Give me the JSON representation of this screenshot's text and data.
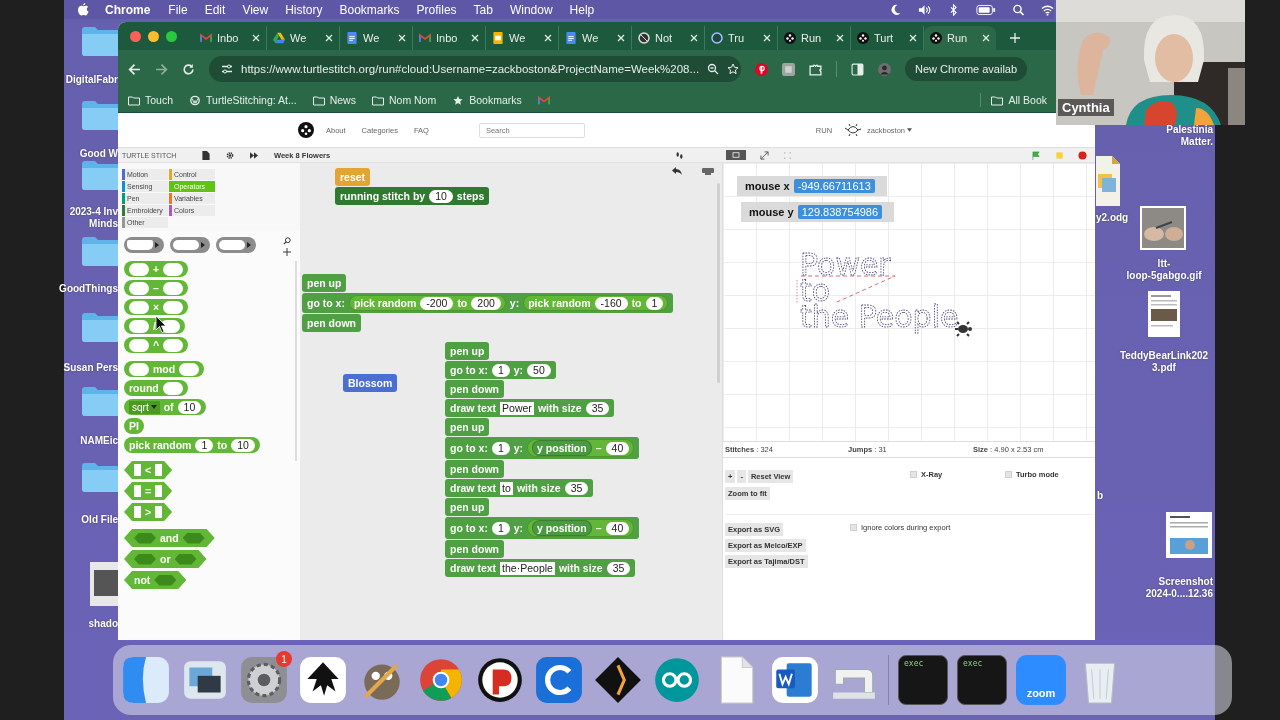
{
  "menu_bar": {
    "app": "Chrome",
    "items": [
      "File",
      "Edit",
      "View",
      "History",
      "Bookmarks",
      "Profiles",
      "Tab",
      "Window",
      "Help"
    ]
  },
  "desktop_left": [
    {
      "kind": "folder",
      "lines": [
        "DigitalFabr"
      ]
    },
    {
      "kind": "folder",
      "lines": [
        "Good W"
      ]
    },
    {
      "kind": "folder",
      "lines": [
        "2023-4 Inv",
        "Minds"
      ]
    },
    {
      "kind": "folder",
      "lines": [
        "GoodThings"
      ]
    },
    {
      "kind": "folder",
      "lines": [
        "Susan Pers"
      ]
    },
    {
      "kind": "folder",
      "lines": [
        "NAMEic"
      ]
    },
    {
      "kind": "folder",
      "lines": [
        "Old File"
      ]
    },
    {
      "kind": "file",
      "lines": [
        "shado"
      ]
    }
  ],
  "desktop_right": [
    {
      "kind": "label",
      "lines": [
        "Palestinia",
        "Matter."
      ]
    },
    {
      "kind": "odg",
      "lines": [
        "y2.odg"
      ]
    },
    {
      "kind": "gif",
      "lines": [
        "ltt-",
        "loop-5gabgo.gif"
      ]
    },
    {
      "kind": "pdf",
      "lines": [
        "TeddyBearLink202",
        "3.pdf"
      ]
    },
    {
      "kind": "label",
      "lines": [
        "b"
      ]
    },
    {
      "kind": "screenshot",
      "lines": [
        "Screenshot",
        "2024-0....12.36"
      ]
    }
  ],
  "browser": {
    "tabs": [
      {
        "kind": "gmail",
        "label": "Inbo",
        "selected": false
      },
      {
        "kind": "drive",
        "label": "We",
        "selected": false
      },
      {
        "kind": "docs",
        "label": "We",
        "selected": false
      },
      {
        "kind": "gmail",
        "label": "Inbo",
        "selected": false
      },
      {
        "kind": "slides",
        "label": "We",
        "selected": false
      },
      {
        "kind": "docs",
        "label": "We",
        "selected": false
      },
      {
        "kind": "notion",
        "label": "Not",
        "selected": false
      },
      {
        "kind": "letter",
        "label": "Tru",
        "selected": false
      },
      {
        "kind": "turtle",
        "label": "Run",
        "selected": false
      },
      {
        "kind": "turtle",
        "label": "Turt",
        "selected": false
      },
      {
        "kind": "turtle",
        "label": "Run",
        "selected": true
      }
    ],
    "url": "https://www.turtlestitch.org/run#cloud:Username=zackboston&ProjectName=Week%208...",
    "update_button": "New Chrome availab",
    "bookmarks": [
      {
        "kind": "folder",
        "label": "Touch"
      },
      {
        "kind": "wordpress",
        "label": "TurtleStitching: At..."
      },
      {
        "kind": "folder",
        "label": "News"
      },
      {
        "kind": "folder",
        "label": "Nom Nom"
      },
      {
        "kind": "star",
        "label": "Bookmarks"
      },
      {
        "kind": "gmail"
      }
    ],
    "all_bookmarks": "All Book"
  },
  "site_header": {
    "nav": [
      "About",
      "Categories",
      "FAQ"
    ],
    "search_placeholder": "Search",
    "run": "RUN",
    "user": "zackboston"
  },
  "ide": {
    "logo": "TURTLE STITCH",
    "project_name": "Week 8 Flowers",
    "categories": [
      {
        "label": "Motion",
        "color": "#4a6cd4",
        "selected": false
      },
      {
        "label": "Control",
        "color": "#e6a822",
        "selected": false
      },
      {
        "label": "Sensing",
        "color": "#0494dc",
        "selected": false
      },
      {
        "label": "Operators",
        "color": "#62c213",
        "selected": true
      },
      {
        "label": "Pen",
        "color": "#00a178",
        "selected": false
      },
      {
        "label": "Variables",
        "color": "#f3761d",
        "selected": false
      },
      {
        "label": "Embroidery",
        "color": "#2e7d32",
        "selected": false
      },
      {
        "label": "Colors",
        "color": "#b053c9",
        "selected": false
      },
      {
        "label": "Other",
        "color": "#969696",
        "selected": false
      }
    ],
    "palette": [
      [
        {
          "kind": "command_ring"
        },
        {
          "kind": "reporter_ring"
        },
        {
          "kind": "predicate_ring"
        }
      ],
      [
        {
          "kind": "reporter",
          "color": "#62b836",
          "parts": [
            {
              "kind": "empty"
            },
            {
              "kind": "label",
              "text": "+"
            },
            {
              "kind": "empty"
            }
          ]
        },
        {
          "kind": "reporter",
          "color": "#62b836",
          "parts": [
            {
              "kind": "empty"
            },
            {
              "kind": "label",
              "text": "–"
            },
            {
              "kind": "empty"
            }
          ]
        },
        {
          "kind": "reporter",
          "color": "#62b836",
          "parts": [
            {
              "kind": "empty"
            },
            {
              "kind": "label",
              "text": "×"
            },
            {
              "kind": "empty"
            }
          ]
        },
        {
          "kind": "reporter",
          "color": "#62b836",
          "parts": [
            {
              "kind": "empty"
            },
            {
              "kind": "label",
              "text": "/"
            },
            {
              "kind": "empty"
            }
          ]
        },
        {
          "kind": "reporter",
          "color": "#62b836",
          "parts": [
            {
              "kind": "empty"
            },
            {
              "kind": "label",
              "text": "^"
            },
            {
              "kind": "empty"
            }
          ]
        }
      ],
      [
        {
          "kind": "reporter",
          "color": "#62b836",
          "parts": [
            {
              "kind": "empty"
            },
            {
              "kind": "label",
              "text": "mod"
            },
            {
              "kind": "empty"
            }
          ]
        },
        {
          "kind": "reporter",
          "color": "#62b836",
          "parts": [
            {
              "kind": "label",
              "text": "round"
            },
            {
              "kind": "empty"
            }
          ]
        },
        {
          "kind": "reporter",
          "color": "#62b836",
          "parts": [
            {
              "kind": "dropdown",
              "text": "sqrt"
            },
            {
              "kind": "label",
              "text": "of"
            },
            {
              "kind": "num",
              "text": "10"
            }
          ]
        },
        {
          "kind": "reporter",
          "color": "#62b836",
          "parts": [
            {
              "kind": "label",
              "text": "PI"
            }
          ]
        },
        {
          "kind": "reporter",
          "color": "#62b836",
          "parts": [
            {
              "kind": "label",
              "text": "pick random"
            },
            {
              "kind": "num",
              "text": "1"
            },
            {
              "kind": "label",
              "text": "to"
            },
            {
              "kind": "num",
              "text": "10"
            }
          ]
        }
      ],
      [
        {
          "kind": "predicate",
          "color": "#62b836",
          "parts": [
            {
              "kind": "rect"
            },
            {
              "kind": "label",
              "text": "<"
            },
            {
              "kind": "rect"
            }
          ]
        },
        {
          "kind": "predicate",
          "color": "#62b836",
          "parts": [
            {
              "kind": "rect"
            },
            {
              "kind": "label",
              "text": "="
            },
            {
              "kind": "rect"
            }
          ]
        },
        {
          "kind": "predicate",
          "color": "#62b836",
          "parts": [
            {
              "kind": "rect"
            },
            {
              "kind": "label",
              "text": ">"
            },
            {
              "kind": "rect"
            }
          ]
        }
      ],
      [
        {
          "kind": "predicate",
          "color": "#62b836",
          "parts": [
            {
              "kind": "bool"
            },
            {
              "kind": "label",
              "text": "and"
            },
            {
              "kind": "bool"
            }
          ]
        },
        {
          "kind": "predicate",
          "color": "#62b836",
          "parts": [
            {
              "kind": "bool"
            },
            {
              "kind": "label",
              "text": "or"
            },
            {
              "kind": "bool"
            }
          ]
        },
        {
          "kind": "predicate",
          "color": "#62b836",
          "parts": [
            {
              "kind": "label",
              "text": "not"
            },
            {
              "kind": "bool"
            }
          ]
        }
      ]
    ],
    "scripts": [
      [
        {
          "kind": "command",
          "color": "#e3a531",
          "parts": [
            {
              "kind": "label",
              "text": "reset"
            }
          ]
        },
        {
          "kind": "command",
          "color": "#2f7a30",
          "parts": [
            {
              "kind": "label",
              "text": "running stitch by"
            },
            {
              "kind": "num",
              "text": "10"
            },
            {
              "kind": "label",
              "text": "steps"
            }
          ]
        }
      ],
      [
        {
          "kind": "command",
          "color": "#4f9f43",
          "parts": [
            {
              "kind": "label",
              "text": "pen up"
            }
          ]
        },
        {
          "kind": "command",
          "color": "#4f9f43",
          "parts": [
            {
              "kind": "label",
              "text": "go to x:"
            },
            {
              "kind": "block",
              "block": {
                "kind": "reporter",
                "color": "#62b836",
                "parts": [
                  {
                    "kind": "label",
                    "text": "pick random"
                  },
                  {
                    "kind": "num",
                    "text": "-200"
                  },
                  {
                    "kind": "label",
                    "text": "to"
                  },
                  {
                    "kind": "num",
                    "text": "200"
                  }
                ]
              }
            },
            {
              "kind": "label",
              "text": "y:"
            },
            {
              "kind": "block",
              "block": {
                "kind": "reporter",
                "color": "#62b836",
                "parts": [
                  {
                    "kind": "label",
                    "text": "pick random"
                  },
                  {
                    "kind": "num",
                    "text": "-160"
                  },
                  {
                    "kind": "label",
                    "text": "to"
                  },
                  {
                    "kind": "num",
                    "text": "1"
                  }
                ]
              }
            }
          ]
        },
        {
          "kind": "command",
          "color": "#4f9f43",
          "parts": [
            {
              "kind": "label",
              "text": "pen down"
            }
          ]
        }
      ],
      [
        {
          "kind": "command",
          "color": "#4a6fd1",
          "parts": [
            {
              "kind": "label",
              "text": "Blossom"
            }
          ]
        }
      ],
      [
        {
          "kind": "command",
          "color": "#4f9f43",
          "parts": [
            {
              "kind": "label",
              "text": "pen up"
            }
          ]
        },
        {
          "kind": "command",
          "color": "#4f9f43",
          "parts": [
            {
              "kind": "label",
              "text": "go to x:"
            },
            {
              "kind": "num",
              "text": "1"
            },
            {
              "kind": "label",
              "text": "y:"
            },
            {
              "kind": "num",
              "text": "50"
            }
          ]
        },
        {
          "kind": "command",
          "color": "#4f9f43",
          "parts": [
            {
              "kind": "label",
              "text": "pen down"
            }
          ]
        },
        {
          "kind": "command",
          "color": "#4f9f43",
          "parts": [
            {
              "kind": "label",
              "text": "draw text"
            },
            {
              "kind": "text",
              "text": "Power"
            },
            {
              "kind": "label",
              "text": "with size"
            },
            {
              "kind": "num",
              "text": "35"
            }
          ]
        },
        {
          "kind": "command",
          "color": "#4f9f43",
          "parts": [
            {
              "kind": "label",
              "text": "pen up"
            }
          ]
        },
        {
          "kind": "command",
          "color": "#4f9f43",
          "parts": [
            {
              "kind": "label",
              "text": "go to x:"
            },
            {
              "kind": "num",
              "text": "1"
            },
            {
              "kind": "label",
              "text": "y:"
            },
            {
              "kind": "block",
              "block": {
                "kind": "reporter",
                "color": "#62b836",
                "parts": [
                  {
                    "kind": "block",
                    "block": {
                      "kind": "reporter",
                      "color": "#4a9a40",
                      "parts": [
                        {
                          "kind": "label",
                          "text": "y position"
                        }
                      ]
                    }
                  },
                  {
                    "kind": "label",
                    "text": "–"
                  },
                  {
                    "kind": "num",
                    "text": "40"
                  }
                ]
              }
            }
          ]
        },
        {
          "kind": "command",
          "color": "#4f9f43",
          "parts": [
            {
              "kind": "label",
              "text": "pen down"
            }
          ]
        },
        {
          "kind": "command",
          "color": "#4f9f43",
          "parts": [
            {
              "kind": "label",
              "text": "draw text"
            },
            {
              "kind": "text",
              "text": "to"
            },
            {
              "kind": "label",
              "text": "with size"
            },
            {
              "kind": "num",
              "text": "35"
            }
          ]
        },
        {
          "kind": "command",
          "color": "#4f9f43",
          "parts": [
            {
              "kind": "label",
              "text": "pen up"
            }
          ]
        },
        {
          "kind": "command",
          "color": "#4f9f43",
          "parts": [
            {
              "kind": "label",
              "text": "go to x:"
            },
            {
              "kind": "num",
              "text": "1"
            },
            {
              "kind": "label",
              "text": "y:"
            },
            {
              "kind": "block",
              "block": {
                "kind": "reporter",
                "color": "#62b836",
                "parts": [
                  {
                    "kind": "block",
                    "block": {
                      "kind": "reporter",
                      "color": "#4a9a40",
                      "parts": [
                        {
                          "kind": "label",
                          "text": "y position"
                        }
                      ]
                    }
                  },
                  {
                    "kind": "label",
                    "text": "–"
                  },
                  {
                    "kind": "num",
                    "text": "40"
                  }
                ]
              }
            }
          ]
        },
        {
          "kind": "command",
          "color": "#4f9f43",
          "parts": [
            {
              "kind": "label",
              "text": "pen down"
            }
          ]
        },
        {
          "kind": "command",
          "color": "#4f9f43",
          "parts": [
            {
              "kind": "label",
              "text": "draw text"
            },
            {
              "kind": "text",
              "text": "the·People"
            },
            {
              "kind": "label",
              "text": "with size"
            },
            {
              "kind": "num",
              "text": "35"
            }
          ]
        }
      ]
    ],
    "stage": {
      "watchers": [
        {
          "label": "mouse x",
          "value": "-949.66711613"
        },
        {
          "label": "mouse y",
          "value": "129.838754986"
        }
      ],
      "drawing": [
        "Power",
        "to",
        "the People"
      ],
      "stats": [
        "**Stitches** : 324",
        "**Jumps** : 31",
        "**Size** : 4.90 x 2.53 cm"
      ],
      "zoom_buttons": [
        "+",
        "-",
        "Reset View"
      ],
      "zoom_fit": "Zoom to fit",
      "options": [
        {
          "label": "X-Ray",
          "checked": false
        },
        {
          "label": "Turbo mode",
          "checked": false
        }
      ],
      "exports": [
        "Export as SVG",
        "Export as Melco/EXP",
        "Export as Tajima/DST"
      ],
      "ignore_colors": {
        "label": "Ignore colors during export",
        "checked": false
      }
    }
  },
  "webcam": {
    "name": "Cynthia"
  },
  "dock": [
    {
      "kind": "finder"
    },
    {
      "kind": "preview"
    },
    {
      "kind": "settings",
      "badge": "1"
    },
    {
      "kind": "inkscape"
    },
    {
      "kind": "gimp"
    },
    {
      "kind": "chrome"
    },
    {
      "kind": "pencil"
    },
    {
      "kind": "c"
    },
    {
      "kind": "fusion"
    },
    {
      "kind": "arduino"
    },
    {
      "kind": "document"
    },
    {
      "kind": "word"
    },
    {
      "kind": "sewing"
    },
    {
      "kind": "separator"
    },
    {
      "kind": "terminal",
      "label": "exec"
    },
    {
      "kind": "terminal",
      "label": "exec"
    },
    {
      "kind": "zoom",
      "label": "zoom"
    },
    {
      "kind": "trash"
    }
  ]
}
